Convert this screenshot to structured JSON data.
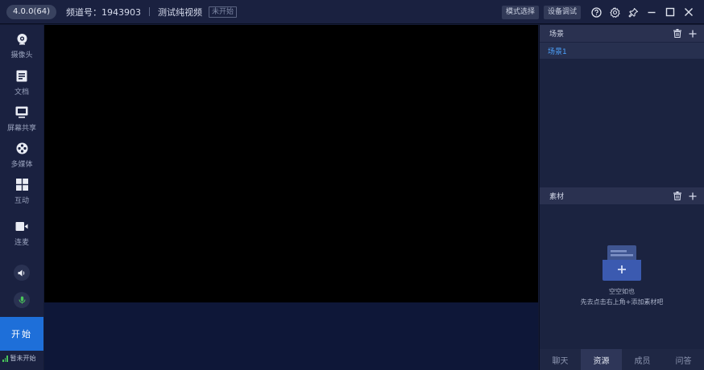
{
  "titlebar": {
    "version": "4.0.0(64)",
    "channel": "频道号：1943903",
    "channel_name": "测试纯视频",
    "status_tag": "未开始",
    "mode_button": "模式选择",
    "device_button": "设备调试"
  },
  "sidebar": {
    "items": [
      {
        "label": "摄像头",
        "icon": "camera-icon"
      },
      {
        "label": "文档",
        "icon": "document-icon"
      },
      {
        "label": "屏幕共享",
        "icon": "screen-share-icon"
      },
      {
        "label": "多媒体",
        "icon": "film-reel-icon"
      },
      {
        "label": "互动",
        "icon": "grid-icon"
      },
      {
        "label": "连麦",
        "icon": "video-call-icon"
      }
    ],
    "start_label": "开始",
    "live_status": "暂未开始"
  },
  "scenes": {
    "title": "场景",
    "items": [
      "场景1"
    ]
  },
  "materials": {
    "title": "素材",
    "empty_title": "空空如也",
    "empty_hint": "先去点击右上角+添加素材吧"
  },
  "tabs": [
    {
      "label": "聊天",
      "active": false
    },
    {
      "label": "资源",
      "active": true
    },
    {
      "label": "成员",
      "active": false
    },
    {
      "label": "问答",
      "active": false
    }
  ],
  "colors": {
    "accent": "#1e6fd9",
    "scene_selected_text": "#4da3ff",
    "mic_green": "#49c45b"
  }
}
